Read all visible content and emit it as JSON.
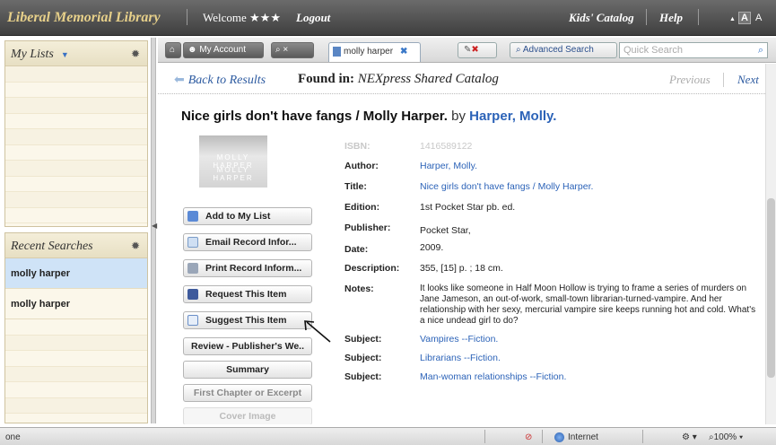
{
  "topbar": {
    "brand": "Liberal Memorial Library",
    "welcome": "Welcome ★★★",
    "logout": "Logout",
    "kids_catalog": "Kids' Catalog",
    "help": "Help",
    "font_small": "A",
    "font_large": "A"
  },
  "left": {
    "my_lists": {
      "title": "My Lists"
    },
    "recent": {
      "title": "Recent Searches",
      "items": [
        "molly harper",
        "molly harper"
      ]
    }
  },
  "tabs": {
    "my_account": "My Account",
    "search_close": "×",
    "active_tab": "molly harper",
    "advanced_search": "Advanced Search",
    "quick_search_placeholder": "Quick Search"
  },
  "nav": {
    "back": "Back to Results",
    "found_in_label": "Found in:",
    "found_in_value": "NEXpress Shared Catalog",
    "previous": "Previous",
    "next": "Next"
  },
  "record": {
    "title": "Nice girls don't have fangs / Molly Harper.",
    "by": "by",
    "author_link": "Harper, Molly.",
    "cover_text_1": "MOLLY HARPER",
    "cover_text_2": "MOLLY HARPER",
    "fields": {
      "isbn_label": "ISBN:",
      "isbn": "1416589122",
      "author_label": "Author:",
      "author": "Harper, Molly.",
      "title_label": "Title:",
      "title": "Nice girls don't have fangs / Molly Harper.",
      "edition_label": "Edition:",
      "edition": "1st Pocket Star pb. ed.",
      "publisher_label": "Publisher:",
      "publisher": "Pocket Star,",
      "date_label": "Date:",
      "date": "2009.",
      "description_label": "Description:",
      "description": "355, [15] p. ; 18 cm.",
      "notes_label": "Notes:",
      "notes": "It looks like someone in Half Moon Hollow is trying to frame a series of murders on Jane Jameson, an out-of-work, small-town librarian-turned-vampire. And her relationship with her sexy, mercurial vampire sire keeps running hot and cold. What's a nice undead girl to do?",
      "subject_label": "Subject:",
      "subjects": [
        "Vampires --Fiction.",
        "Librarians --Fiction.",
        "Man-woman relationships --Fiction."
      ]
    }
  },
  "actions": {
    "add_to_list": "Add to My List",
    "email": "Email Record Infor...",
    "print": "Print Record Inform...",
    "request": "Request This Item",
    "suggest": "Suggest This Item",
    "review": "Review - Publisher's We..",
    "summary": "Summary",
    "first_chapter": "First Chapter or Excerpt",
    "cover_image": "Cover Image"
  },
  "status": {
    "left": "one",
    "zone": "Internet",
    "zoom": "100%"
  },
  "colors": {
    "link": "#2c63b8",
    "brand": "#e7d08a",
    "selected_row": "#cfe3f7"
  }
}
